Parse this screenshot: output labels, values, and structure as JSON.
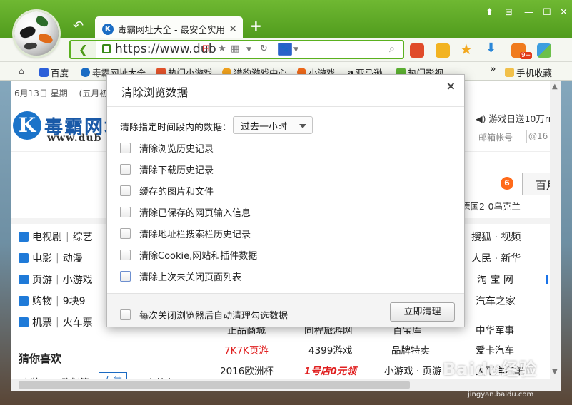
{
  "tab": {
    "title": "毒霸网址大全 - 最安全实用...",
    "close": "✕",
    "new": "+"
  },
  "window": {
    "restore": "⬆",
    "min": "—",
    "max": "☐",
    "close": "✕"
  },
  "address": {
    "url": "https://www.dub",
    "back": "❮"
  },
  "toolbar": {
    "search_engine": "🐾",
    "ext_badge": "9+"
  },
  "bookmarks": {
    "items": [
      "百度",
      "毒霸网址大全",
      "热门小游戏",
      "猎豹游戏中心",
      "小游戏",
      "亚马逊",
      "热门影视"
    ],
    "overflow": "»",
    "mobile": "手机收藏"
  },
  "page": {
    "date": "6月13日 星期一 (五月初",
    "site_name": "毒霸网址",
    "site_url": "www.dub",
    "right_info": "◀) 游戏日送10万rr",
    "mail_placeholder": "邮箱帐号",
    "mail_suffix": "@16",
    "badge": "6",
    "search_btn": "百月",
    "hotword": "德国2-0乌克兰",
    "categories": [
      {
        "a": "电视剧",
        "b": "综艺"
      },
      {
        "a": "电影",
        "b": "动漫"
      },
      {
        "a": "页游",
        "b": "小游戏"
      },
      {
        "a": "购物",
        "b": "9块9"
      },
      {
        "a": "机票",
        "b": "火车票"
      }
    ],
    "right_sites": [
      "搜狐 · 视频",
      "人民 · 新华",
      "淘 宝 网",
      "汽车之家",
      "中华军事",
      "爱卡汽车",
      "太平洋汽车"
    ],
    "guess_title": "猜你喜欢",
    "guess_tabs": [
      "直装",
      "购划算",
      "女装",
      "九块九"
    ],
    "row1": [
      "正品商城",
      "同程旅游网",
      "百宝库",
      "中华军事"
    ],
    "row2": [
      "7K7K页游",
      "4399游戏",
      "品牌特卖",
      "爱卡汽车"
    ],
    "row3": [
      "2016欧洲杯",
      "1号店0元领",
      "小游戏 · 页游",
      "太平洋汽车"
    ],
    "watermark": "Baidu经验",
    "watermark_sub": "jingyan.baidu.com"
  },
  "dialog": {
    "title": "清除浏览数据",
    "close": "×",
    "range_label": "清除指定时间段内的数据：",
    "range_value": "过去一小时",
    "options": [
      "清除浏览历史记录",
      "清除下载历史记录",
      "缓存的图片和文件",
      "清除已保存的网页输入信息",
      "清除地址栏搜索栏历史记录",
      "清除Cookie,网站和插件数据",
      "清除上次未关闭页面列表"
    ],
    "auto_clear": "每次关闭浏览器后自动清理勾选数据",
    "clear_button": "立即清理"
  }
}
